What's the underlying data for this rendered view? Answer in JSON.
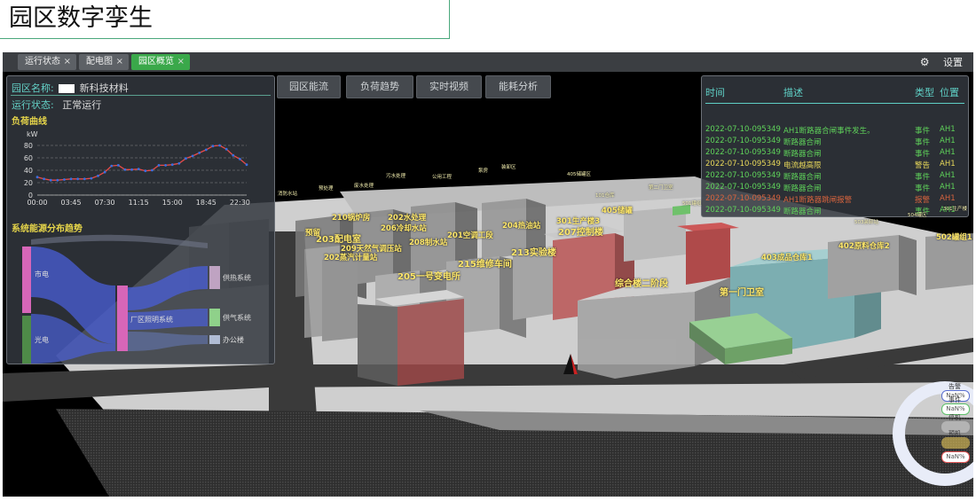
{
  "slide_title": "园区数字孪生",
  "tabs": [
    {
      "label": "运行状态",
      "close": "×"
    },
    {
      "label": "配电图",
      "close": "×"
    },
    {
      "label": "园区概览",
      "close": "×",
      "active": true
    }
  ],
  "settings_label": "设置",
  "toolbar": [
    "园区能流",
    "负荷趋势",
    "实时视频",
    "能耗分析"
  ],
  "left_panel": {
    "park_name_label": "园区名称:",
    "park_name_value": "新科技材料",
    "status_label": "运行状态:",
    "status_value": "正常运行",
    "load_curve_title": "负荷曲线",
    "energy_flow_title": "系统能源分布趋势"
  },
  "chart_data": {
    "type": "line",
    "ylabel": "kW",
    "ylim": [
      0,
      80
    ],
    "yticks": [
      0,
      20,
      40,
      60,
      80
    ],
    "x_ticks": [
      "00:00",
      "03:45",
      "07:30",
      "11:15",
      "15:00",
      "18:45",
      "22:30"
    ],
    "x": [
      0,
      0.75,
      1.5,
      2.25,
      3,
      3.75,
      4.5,
      5.25,
      6,
      6.75,
      7.5,
      8.25,
      9,
      9.75,
      10.5,
      11.25,
      12,
      12.75,
      13.5,
      14.25,
      15,
      15.75,
      16.5,
      17.25,
      18,
      18.75,
      19.5,
      20.25,
      21,
      21.75,
      22.5,
      23.25
    ],
    "series": [
      {
        "values": [
          29,
          26,
          24,
          24,
          25,
          26,
          26,
          26,
          27,
          31,
          37,
          47,
          48,
          41,
          41,
          42,
          39,
          40,
          48,
          48,
          49,
          51,
          59,
          63,
          68,
          73,
          79,
          80,
          74,
          64,
          58,
          49
        ]
      }
    ],
    "color": "#e84a4a",
    "grid": "dashed-horizontal"
  },
  "sankey": {
    "sources": [
      {
        "label": "市电",
        "color": "#d766b8"
      },
      {
        "label": "光电",
        "color": "#4e8a48"
      }
    ],
    "middle": {
      "label": "厂区照明系统",
      "color": "#d766b8"
    },
    "targets": [
      {
        "label": "供热系统",
        "color": "#bfa3c2"
      },
      {
        "label": "供气系统",
        "color": "#8fd18a"
      },
      {
        "label": "办公楼",
        "color": "#b0bcd4"
      }
    ],
    "flow_color": "#4a5fd8"
  },
  "events": {
    "headers": [
      "时间",
      "描述",
      "类型",
      "位置"
    ],
    "rows": [
      {
        "time": "2022-07-10-095349",
        "desc": "AH1断路器合闸事件发生。",
        "type": "事件",
        "loc": "AH1",
        "color": "#5fd35a"
      },
      {
        "time": "2022-07-10-095349",
        "desc": "断路器合闸",
        "type": "事件",
        "loc": "AH1",
        "color": "#5fd35a"
      },
      {
        "time": "2022-07-10-095349",
        "desc": "断路器合闸",
        "type": "事件",
        "loc": "AH1",
        "color": "#5fd35a"
      },
      {
        "time": "2022-07-10-095349",
        "desc": "电流越高限",
        "type": "警告",
        "loc": "AH1",
        "color": "#e8d85a"
      },
      {
        "time": "2022-07-10-095349",
        "desc": "断路器合闸",
        "type": "事件",
        "loc": "AH1",
        "color": "#5fd35a"
      },
      {
        "time": "2022-07-10-095349",
        "desc": "断路器合闸",
        "type": "事件",
        "loc": "AH1",
        "color": "#5fd35a"
      },
      {
        "time": "2022-07-10-095349",
        "desc": "AH1断路器跳闸报警",
        "type": "报警",
        "loc": "AH1",
        "color": "#d8643e"
      },
      {
        "time": "2022-07-10-095349",
        "desc": "断路器合闸",
        "type": "事件",
        "loc": "AH1",
        "color": "#5fd35a"
      }
    ]
  },
  "building_labels": [
    {
      "text": "203配电室",
      "size": "big"
    },
    {
      "text": "202蒸汽计量站",
      "size": "normal"
    },
    {
      "text": "209天然气调压站",
      "size": "normal"
    },
    {
      "text": "206冷却水站",
      "size": "normal"
    },
    {
      "text": "208制水站",
      "size": "normal"
    },
    {
      "text": "201空调工段",
      "size": "normal"
    },
    {
      "text": "204热油站",
      "size": "normal"
    },
    {
      "text": "213实验楼",
      "size": "big"
    },
    {
      "text": "215维修车间",
      "size": "big"
    },
    {
      "text": "205一号变电所",
      "size": "big"
    },
    {
      "text": "207控制楼",
      "size": "big"
    },
    {
      "text": "综合楼二阶段",
      "size": "big"
    },
    {
      "text": "第一门卫室",
      "size": "big"
    },
    {
      "text": "403成品仓库1",
      "size": "normal"
    },
    {
      "text": "402原料仓库2",
      "size": "normal"
    },
    {
      "text": "502罐组1",
      "size": "normal"
    },
    {
      "text": "预留",
      "size": "normal"
    },
    {
      "text": "210锅炉房",
      "size": "normal"
    },
    {
      "text": "202水处理",
      "size": "normal"
    },
    {
      "text": "301生产楼3",
      "size": "normal"
    },
    {
      "text": "405储罐",
      "size": "normal"
    },
    {
      "text": "消防水站",
      "size": "tiny"
    },
    {
      "text": "预处理",
      "size": "tiny"
    },
    {
      "text": "废水处理",
      "size": "tiny"
    },
    {
      "text": "污水处理",
      "size": "tiny"
    },
    {
      "text": "公用工程",
      "size": "tiny"
    },
    {
      "text": "泵房",
      "size": "tiny"
    },
    {
      "text": "装卸区",
      "size": "tiny"
    },
    {
      "text": "405储罐区",
      "size": "tiny"
    },
    {
      "text": "101仓库",
      "size": "tiny"
    },
    {
      "text": "第二门卫室",
      "size": "tiny"
    },
    {
      "text": "501罐组",
      "size": "tiny"
    },
    {
      "text": "503装卸站",
      "size": "tiny"
    },
    {
      "text": "504罐区",
      "size": "tiny"
    },
    {
      "text": "301生产楼",
      "size": "tiny"
    }
  ],
  "status_legend": [
    {
      "label": "告警",
      "value": "NaN%",
      "color": "#5a6fd0"
    },
    {
      "label": "事件",
      "value": "NaN%",
      "color": "#5fc26a"
    },
    {
      "label": "停机",
      "value": "",
      "color": "#cfcfcf"
    },
    {
      "label": "预机",
      "value": "",
      "color": "#e8c85a"
    },
    {
      "label": "",
      "value": "NaN%",
      "color": "#e85a5a"
    }
  ]
}
